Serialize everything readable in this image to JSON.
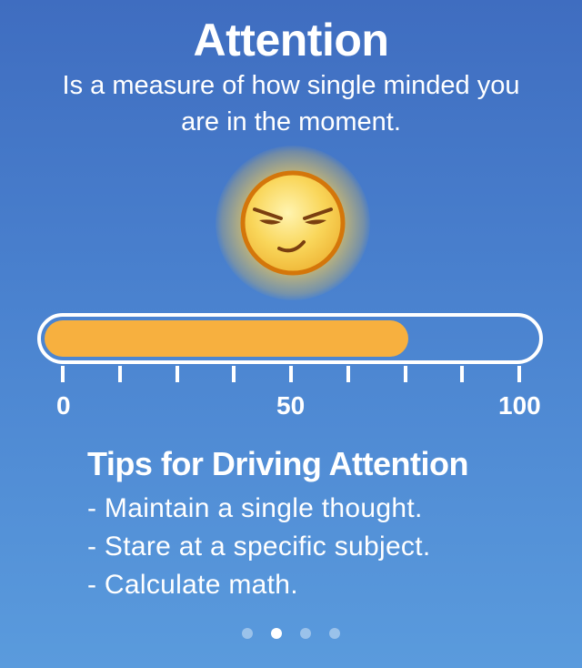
{
  "header": {
    "title": "Attention",
    "subtitle": "Is a measure of how single minded you are in the moment."
  },
  "emoji": {
    "icon": "focused-face-icon",
    "face_color": "#f9d65a",
    "outline_color": "#d4760a"
  },
  "meter": {
    "value": 74,
    "min": 0,
    "max": 100,
    "fill_color": "#f7b03f",
    "labels": {
      "min": "0",
      "mid": "50",
      "max": "100"
    },
    "tick_count": 9
  },
  "tips": {
    "title": "Tips for Driving Attention",
    "items": [
      "- Maintain a single thought.",
      "- Stare at a specific subject.",
      "- Calculate math."
    ]
  },
  "pager": {
    "pages": 4,
    "active_index": 1
  }
}
